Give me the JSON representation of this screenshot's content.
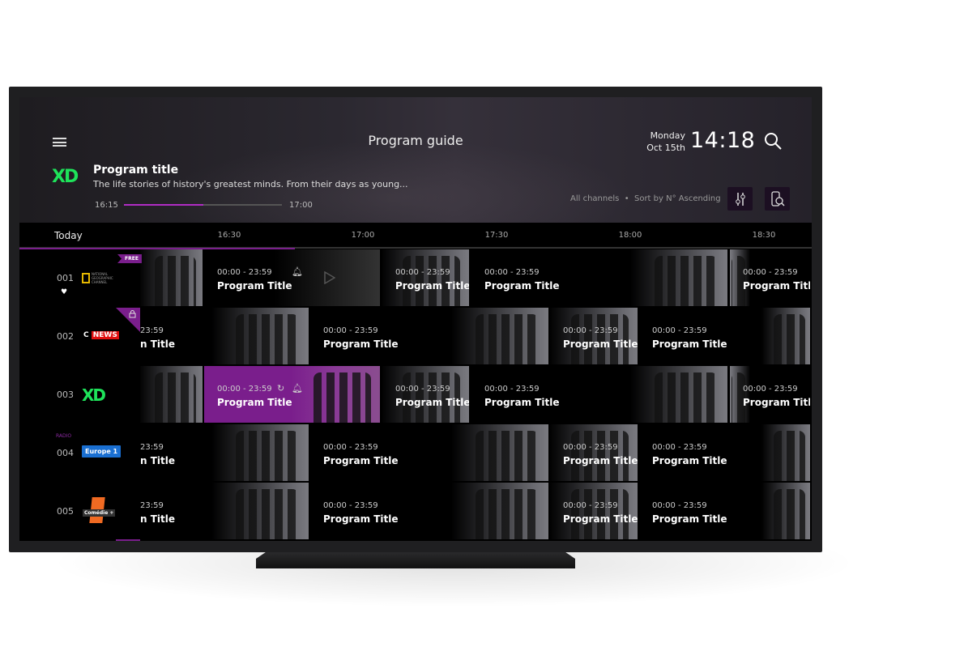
{
  "header": {
    "title": "Program guide",
    "day": "Monday",
    "date": "Oct 15th",
    "clock": "14:18"
  },
  "featured": {
    "channel_logo": "XD",
    "title": "Program title",
    "description": "The life stories of history's greatest minds. From their days as young...",
    "start": "16:15",
    "end": "17:00",
    "progress": 0.5
  },
  "filters": {
    "channels": "All channels",
    "separator": "•",
    "sort": "Sort by N° Ascending"
  },
  "timeline": {
    "today": "Today",
    "ticks": [
      "16:30",
      "17:00",
      "17:30",
      "18:00",
      "18:30"
    ]
  },
  "colors": {
    "accent": "#b02cc4",
    "xd_green": "#1ee35a"
  },
  "channels": [
    {
      "number": "001",
      "logo": "NATIONAL GEOGRAPHIC CHANNEL",
      "badge": "FREE !",
      "favorite": true
    },
    {
      "number": "002",
      "logo": "NEWS",
      "logo_prefix": "C",
      "badge": "lock-icon"
    },
    {
      "number": "003",
      "logo": "XD"
    },
    {
      "number": "004",
      "logo": "Europe 1",
      "label": "RADIO"
    },
    {
      "number": "005",
      "logo": "Comédie +"
    }
  ],
  "programs": {
    "time": "00:00 - 23:59",
    "title": "Program Title",
    "partial_time": "23:59",
    "partial_title": "n Title"
  }
}
